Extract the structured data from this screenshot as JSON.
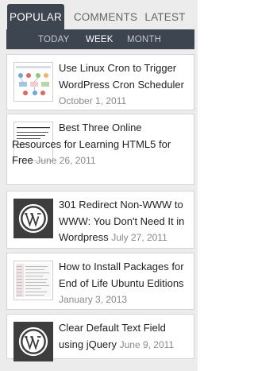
{
  "tabs": [
    {
      "label": "POPULAR",
      "active": true
    },
    {
      "label": "COMMENTS",
      "active": false
    },
    {
      "label": "LATEST",
      "active": false
    }
  ],
  "subtabs": [
    {
      "label": "TODAY",
      "active": false
    },
    {
      "label": "WEEK",
      "active": true
    },
    {
      "label": "MONTH",
      "active": false
    }
  ],
  "posts": [
    {
      "title": "Use Linux Cron to Trigger WordPress Cron Scheduler",
      "date": "October 1, 2011",
      "thumb": "diagram-thumbnail"
    },
    {
      "title": "Best Three Online Resources for Learning HTML5 for Free",
      "date": "June 26, 2011",
      "thumb": "document-thumbnail",
      "thumb_text": "INTRODUCTION THINGS YOU SHOULD KNOW ABOUT HTML5"
    },
    {
      "title": "301 Redirect Non-WWW to WWW: You Don't Need It in Wordpress",
      "date": "July 27, 2011",
      "thumb": "wordpress-icon"
    },
    {
      "title": "How to Install Packages for End of Life Ubuntu Editions",
      "date": "January 3, 2013",
      "thumb": "table-thumbnail"
    },
    {
      "title": "Clear Default Text Field using jQuery",
      "date": "June 9, 2011",
      "thumb": "wordpress-icon"
    }
  ],
  "colors": {
    "tab_active": "#3d4550",
    "background": "#ececec",
    "date": "#888888"
  }
}
